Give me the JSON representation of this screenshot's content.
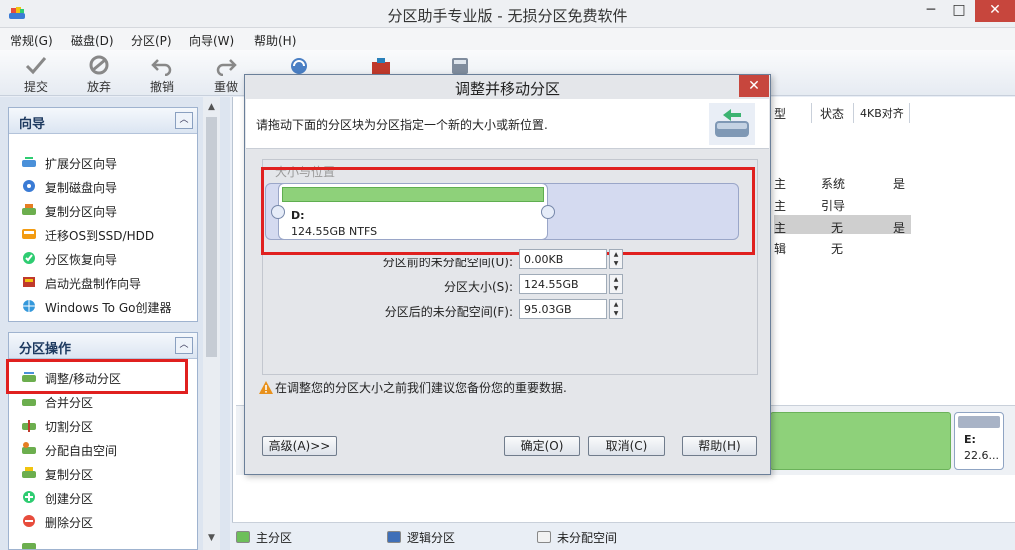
{
  "window": {
    "title": "分区助手专业版 - 无损分区免费软件",
    "min": "─",
    "max": "□",
    "close": "✕"
  },
  "menu": [
    "常规(G)",
    "磁盘(D)",
    "分区(P)",
    "向导(W)",
    "帮助(H)"
  ],
  "toolbar": {
    "submit": "提交",
    "discard": "放弃",
    "undo": "撤销",
    "redo": "重做"
  },
  "sidebar": {
    "wizard_panel": {
      "title": "向导",
      "items": [
        "扩展分区向导",
        "复制磁盘向导",
        "复制分区向导",
        "迁移OS到SSD/HDD",
        "分区恢复向导",
        "启动光盘制作向导",
        "Windows To Go创建器"
      ]
    },
    "ops_panel": {
      "title": "分区操作",
      "items": [
        "调整/移动分区",
        "合并分区",
        "切割分区",
        "分配自由空间",
        "复制分区",
        "创建分区",
        "删除分区"
      ]
    }
  },
  "table": {
    "headers": {
      "type": "型",
      "status": "状态",
      "align4k": "4KB对齐"
    },
    "rows": [
      {
        "type": "主",
        "status": "系统",
        "align4k": "是"
      },
      {
        "type": "主",
        "status": "引导",
        "align4k": ""
      },
      {
        "type": "主",
        "status": "无",
        "align4k": "是"
      },
      {
        "type": "辑",
        "status": "无",
        "align4k": ""
      }
    ]
  },
  "disk_map": {
    "e_label": "E:",
    "e_size": "22.6..."
  },
  "legend": {
    "primary": "主分区",
    "logical": "逻辑分区",
    "unallocated": "未分配空间",
    "colors": {
      "primary": "#6dbf5a",
      "logical": "#3f6fb8",
      "unallocated": "#f2f2f2"
    }
  },
  "dialog": {
    "title": "调整并移动分区",
    "close": "✕",
    "instruction": "请拖动下面的分区块为分区指定一个新的大小或新位置.",
    "group_label": "大小与位置",
    "partition": {
      "name": "D:",
      "info": "124.55GB NTFS"
    },
    "fields": {
      "before_label": "分区前的未分配空间(U):",
      "before_value": "0.00KB",
      "size_label": "分区大小(S):",
      "size_value": "124.55GB",
      "after_label": "分区后的未分配空间(F):",
      "after_value": "95.03GB"
    },
    "warning": "在调整您的分区大小之前我们建议您备份您的重要数据.",
    "buttons": {
      "advanced": "高级(A)>>",
      "ok": "确定(O)",
      "cancel": "取消(C)",
      "help": "帮助(H)"
    }
  }
}
